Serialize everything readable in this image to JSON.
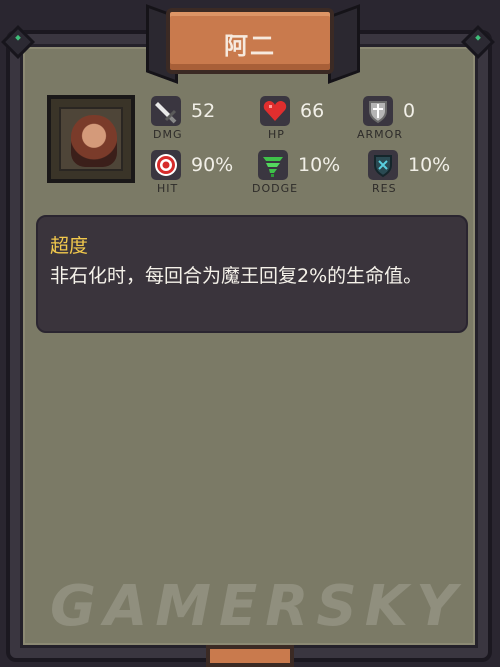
{
  "title": "阿二",
  "stats": {
    "dmg": {
      "value": "52",
      "label": "DMG",
      "icon": "sword-icon"
    },
    "hp": {
      "value": "66",
      "label": "HP",
      "icon": "heart-icon"
    },
    "armor": {
      "value": "0",
      "label": "ARMOR",
      "icon": "shield-icon"
    },
    "hit": {
      "value": "90%",
      "label": "HIT",
      "icon": "target-icon"
    },
    "dodge": {
      "value": "10%",
      "label": "DODGE",
      "icon": "tornado-icon"
    },
    "res": {
      "value": "10%",
      "label": "RES",
      "icon": "magic-shield-icon"
    }
  },
  "ability": {
    "name": "超度",
    "description": "非石化时，每回合为魔王回复2%的生命值。"
  },
  "watermark": "GAMERSKY",
  "colors": {
    "title_plate": "#c97a4d",
    "ability_name": "#f2c94c",
    "panel": "#7b7a66"
  }
}
